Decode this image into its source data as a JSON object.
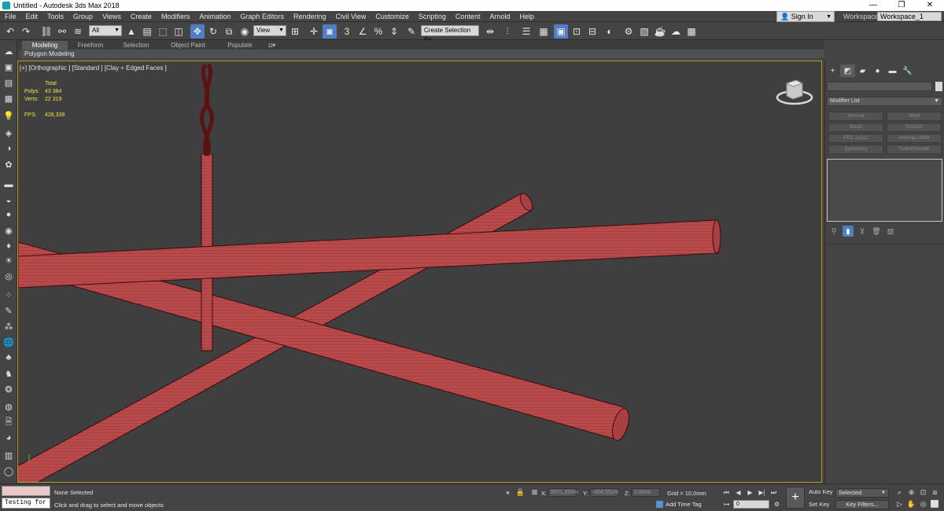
{
  "window": {
    "title": "Untitled - Autodesk 3ds Max 2018",
    "controls": [
      "—",
      "❐",
      "✕"
    ]
  },
  "menubar": {
    "items": [
      "File",
      "Edit",
      "Tools",
      "Group",
      "Views",
      "Create",
      "Modifiers",
      "Animation",
      "Graph Editors",
      "Rendering",
      "Civil View",
      "Customize",
      "Scripting",
      "Content",
      "Arnold",
      "Help"
    ],
    "sign_in": "Sign In",
    "workspaces_label": "Workspaces:",
    "workspace_value": "Workspace_1"
  },
  "toolbar": {
    "selection_filter": "All",
    "reference_coord": "View",
    "snap_label": "3",
    "named_selection_placeholder": "Create Selection Se"
  },
  "ribbon": {
    "tabs": [
      "Modeling",
      "Freeform",
      "Selection",
      "Object Paint",
      "Populate"
    ],
    "active_tab": "Modeling",
    "sub_label": "Polygon Modeling"
  },
  "viewport": {
    "label": "[+] [Orthographic ] [Standard ] [Clay + Edged Faces ]",
    "stats": {
      "header": "Total",
      "polys_label": "Polys:",
      "polys": "43 384",
      "verts_label": "Verts:",
      "verts": "22 319",
      "fps_label": "FPS:",
      "fps": "428,339"
    },
    "object_color": "#b84a4c",
    "background_color": "#3f3f3f"
  },
  "command_panel": {
    "modifier_list": "Modifier List",
    "modifier_buttons": [
      "Normal",
      "Shell",
      "Bend",
      "Smooth",
      "FFD 2x2x2",
      "Unwrap UVW",
      "Symmetry",
      "TurboSmooth"
    ]
  },
  "status": {
    "script_listener": "Testing for :",
    "selection": "None Selected",
    "prompt": "Click and drag to select and move objects",
    "x_label": "X:",
    "x_value": "5571,656m",
    "y_label": "Y:",
    "y_value": "-404,552m",
    "z_label": "Z:",
    "z_value": "0,0mm",
    "grid": "Grid = 10,0mm",
    "add_time_tag": "Add Time Tag",
    "frame": "0",
    "auto_key": "Auto Key",
    "set_key": "Set Key",
    "selected_set": "Selected",
    "key_filters": "Key Filters..."
  }
}
